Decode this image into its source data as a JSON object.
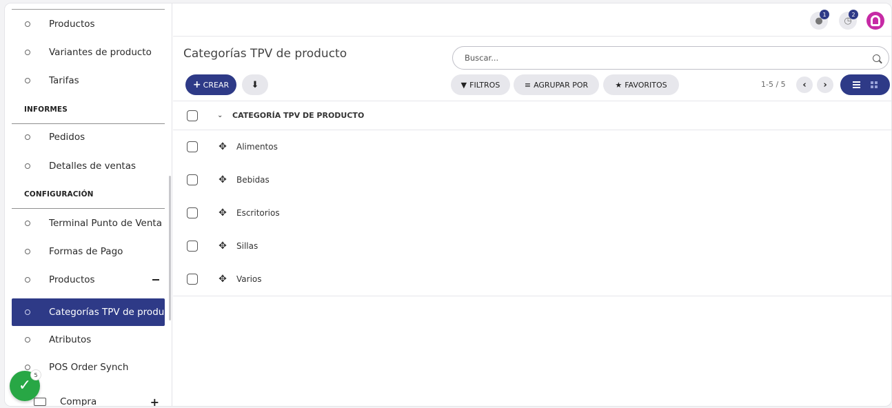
{
  "sidebar": {
    "items_top": [
      "Productos",
      "Variantes de producto",
      "Tarifas"
    ],
    "informes_heading": "INFORMES",
    "informes_items": [
      "Pedidos",
      "Detalles de ventas"
    ],
    "config_heading": "CONFIGURACIÓN",
    "config_items": [
      "Terminal Punto de Venta",
      "Formas de Pago",
      "Productos"
    ],
    "sub_items": [
      "Categorías TPV de producto",
      "Atributos",
      "POS Order Synch"
    ],
    "compra_label": "Compra",
    "compra_toggle": "+",
    "fab_badge": "5"
  },
  "topbar": {
    "messages_badge": "1",
    "activities_badge": "2"
  },
  "page": {
    "title": "Categorías TPV de producto",
    "search_placeholder": "Buscar...",
    "create_label": "CREAR",
    "filters_label": "FILTROS",
    "group_by_label": "AGRUPAR POR",
    "favorites_label": "FAVORITOS",
    "pager": "1-5 / 5"
  },
  "table": {
    "column_header": "CATEGORÍA TPV DE PRODUCTO",
    "rows": [
      "Alimentos",
      "Bebidas",
      "Escritorios",
      "Sillas",
      "Varios"
    ]
  },
  "colors": {
    "primary": "#2e3a87",
    "success": "#28a745",
    "avatar": "#c62aa5"
  }
}
